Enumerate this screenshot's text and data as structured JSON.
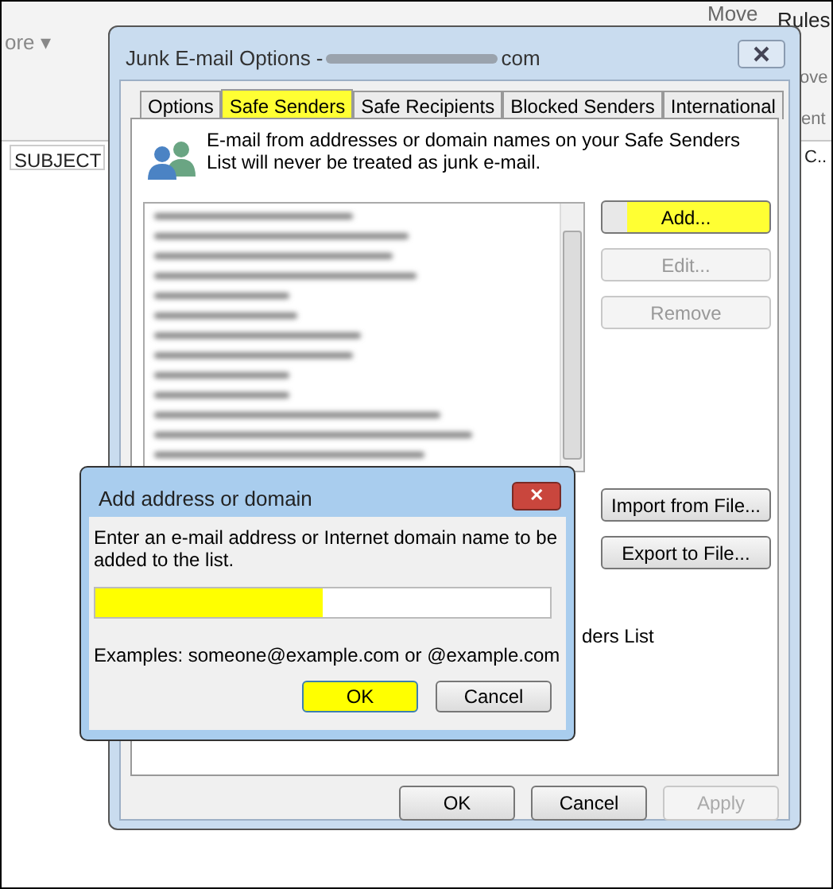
{
  "background": {
    "ribbon_labels": [
      "ore ▾",
      "Move",
      "Rules",
      "ove",
      "ent"
    ],
    "column_header": "SUBJECT",
    "column_header_2": "C.."
  },
  "dialog": {
    "title_start": "Junk E-mail Options -",
    "title_end": "com",
    "tabs": [
      {
        "label": "Options",
        "selected": false,
        "highlighted": false
      },
      {
        "label": "Safe Senders",
        "selected": true,
        "highlighted": true
      },
      {
        "label": "Safe Recipients",
        "selected": false,
        "highlighted": false
      },
      {
        "label": "Blocked Senders",
        "selected": false,
        "highlighted": false
      },
      {
        "label": "International",
        "selected": false,
        "highlighted": false
      }
    ],
    "description": "E-mail from addresses or domain names on your Safe Senders List will never be treated as junk e-mail.",
    "side_buttons": [
      {
        "label": "Add...",
        "disabled": false,
        "highlighted": true
      },
      {
        "label": "Edit...",
        "disabled": true,
        "highlighted": false
      },
      {
        "label": "Remove",
        "disabled": true,
        "highlighted": false
      },
      {
        "label": "Import from File...",
        "disabled": false,
        "highlighted": false
      },
      {
        "label": "Export to File...",
        "disabled": false,
        "highlighted": false
      }
    ],
    "checkbox_label_fragment": "ders List",
    "buttons": [
      {
        "label": "OK",
        "disabled": false
      },
      {
        "label": "Cancel",
        "disabled": false
      },
      {
        "label": "Apply",
        "disabled": true
      }
    ]
  },
  "add_dialog": {
    "title": "Add address or domain",
    "close": "✕",
    "prompt": "Enter an e-mail address or Internet domain name to be added to the list.",
    "field": {
      "highlighted": true
    },
    "examples": "Examples: someone@example.com or @example.com",
    "buttons": [
      {
        "label": "OK",
        "highlighted": true
      },
      {
        "label": "Cancel",
        "highlighted": false
      }
    ]
  }
}
